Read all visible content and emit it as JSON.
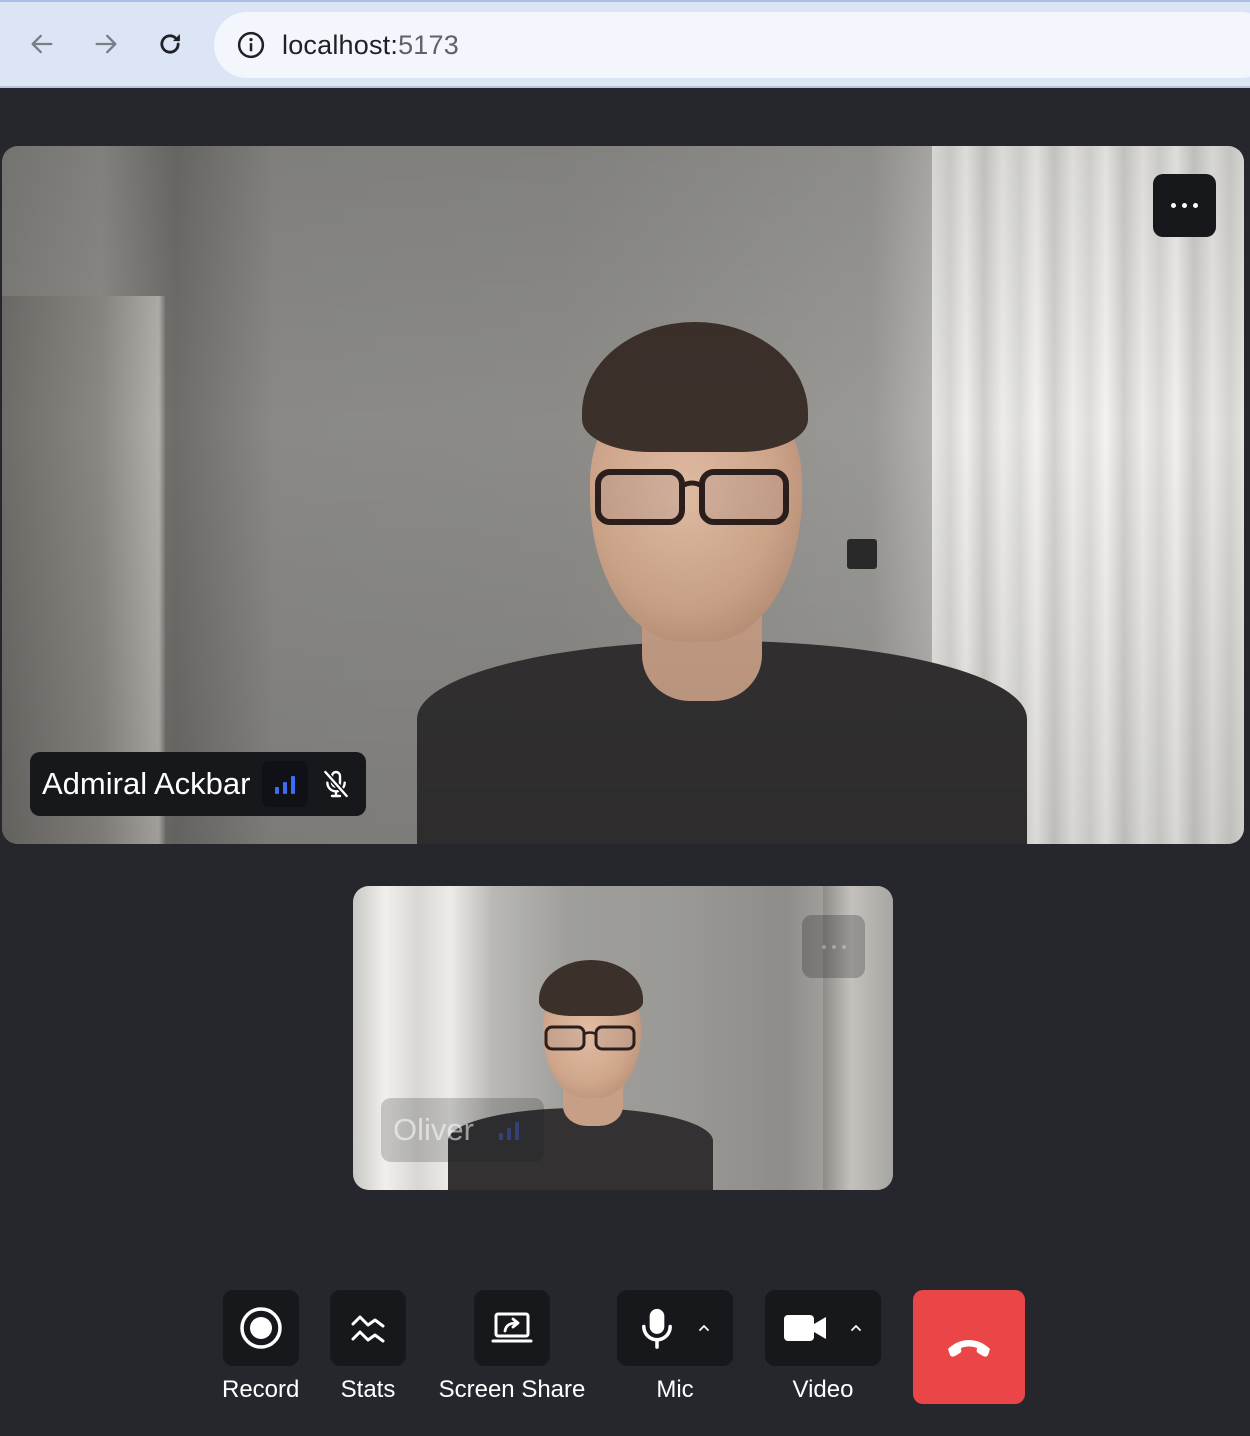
{
  "browser": {
    "url_host": "localhost:",
    "url_port": "5173"
  },
  "participants": {
    "main": {
      "name": "Admiral Ackbar",
      "signal_bars": 3,
      "muted": true
    },
    "self": {
      "name": "Oliver",
      "signal_bars": 3
    }
  },
  "controls": {
    "record_label": "Record",
    "stats_label": "Stats",
    "screen_share_label": "Screen Share",
    "mic_label": "Mic",
    "video_label": "Video"
  },
  "colors": {
    "background": "#26272d",
    "control_bg": "#17181c",
    "end_call": "#ea4648",
    "signal": "#3e6cf4"
  },
  "icons": [
    "back-arrow-icon",
    "forward-arrow-icon",
    "reload-icon",
    "info-icon",
    "more-icon",
    "signal-icon",
    "mic-off-icon",
    "record-icon",
    "stats-icon",
    "screen-share-icon",
    "mic-icon",
    "caret-up-icon",
    "camera-icon",
    "hang-up-icon"
  ]
}
